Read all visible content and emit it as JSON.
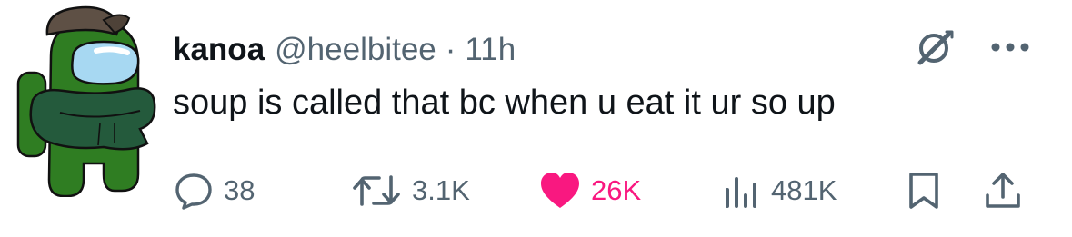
{
  "tweet": {
    "display_name": "kanoa",
    "handle": "@heelbitee",
    "separator": "·",
    "time": "11h",
    "text": "soup is called that bc when u eat it ur so up"
  },
  "actions": {
    "replies": "38",
    "reposts": "3.1K",
    "likes": "26K",
    "views": "481K",
    "liked": true
  },
  "colors": {
    "primary_text": "#0f1419",
    "secondary_text": "#536471",
    "like_pink": "#f91880",
    "avatar_green": "#2f7d22",
    "avatar_visor": "#a7d8f2",
    "hat_brown": "#5e5045"
  },
  "icons": {
    "reply": "speech-bubble-icon",
    "repost": "repost-arrows-icon",
    "like": "heart-filled-icon",
    "views": "bar-chart-icon",
    "bookmark": "bookmark-icon",
    "share": "share-upload-icon",
    "grok": "grok-icon",
    "more": "ellipsis-icon"
  }
}
